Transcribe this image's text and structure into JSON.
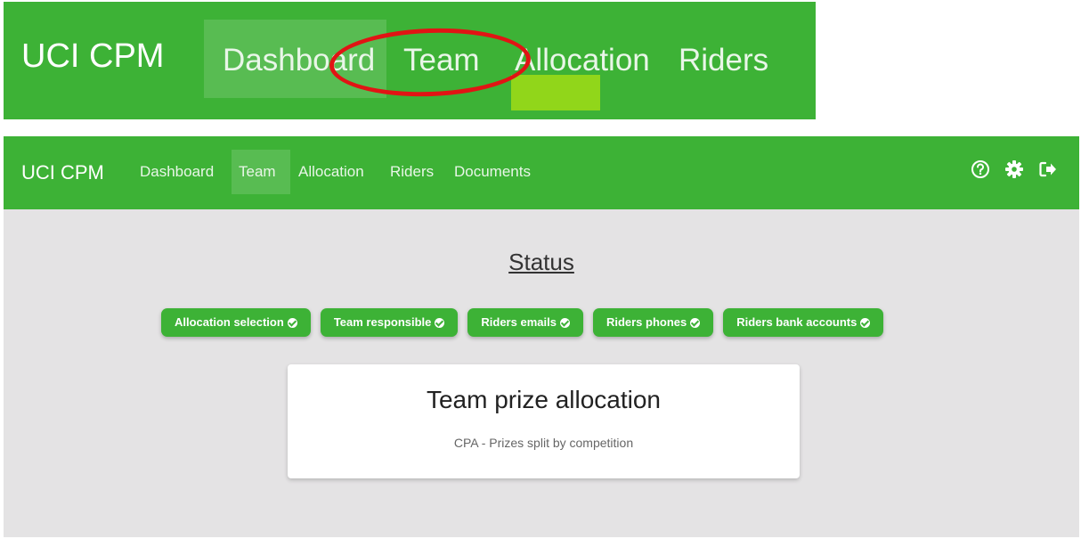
{
  "zoom": {
    "brand": "UCI CPM",
    "links": [
      "Dashboard",
      "Team",
      "Allocation",
      "Riders"
    ]
  },
  "navbar": {
    "brand": "UCI CPM",
    "links": [
      "Dashboard",
      "Team",
      "Allocation",
      "Riders",
      "Documents"
    ],
    "active": "Team",
    "icons": [
      "help-icon",
      "settings-icon",
      "logout-icon"
    ]
  },
  "status": {
    "title": "Status",
    "pills": [
      "Allocation selection",
      "Team responsible",
      "Riders emails",
      "Riders phones",
      "Riders bank accounts"
    ]
  },
  "card": {
    "title": "Team prize allocation",
    "subtitle": "CPA - Prizes split by competition"
  },
  "colors": {
    "brand_green": "#3db236",
    "background": "#e4e3e4",
    "annotation_red": "#e11414",
    "highlight_lime": "#9ad917"
  }
}
